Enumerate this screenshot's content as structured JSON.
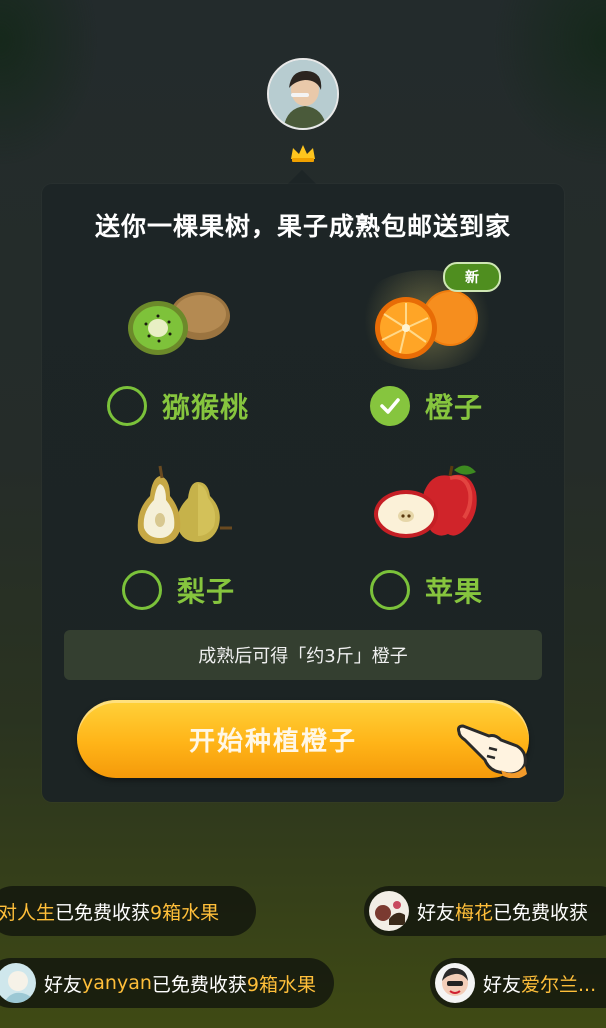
{
  "header": {
    "avatar_icon": "user-avatar",
    "crown_icon": "crown-icon"
  },
  "card": {
    "title": "送你一棵果树，果子成熟包邮送到家",
    "new_badge": "新",
    "options": [
      {
        "label": "猕猴桃",
        "icon": "kiwi-icon",
        "checked": false
      },
      {
        "label": "橙子",
        "icon": "orange-icon",
        "checked": true
      },
      {
        "label": "梨子",
        "icon": "pear-icon",
        "checked": false
      },
      {
        "label": "苹果",
        "icon": "apple-icon",
        "checked": false
      }
    ],
    "info_text": "成熟后可得「约3斤」橙子",
    "start_button": "开始种植橙子",
    "hand_icon": "pointing-hand-icon"
  },
  "tickers": [
    {
      "pre": "",
      "name": "对人生",
      "post": "已免费收获",
      "count": "9箱水果"
    },
    {
      "pre": "好友",
      "name": "梅花",
      "post": "已免费收获",
      "count": ""
    },
    {
      "pre": "好友",
      "name": "yanyan",
      "post": "已免费收获",
      "count": "9箱水果"
    },
    {
      "pre": "好友",
      "name": "爱尔兰...",
      "post": "",
      "count": ""
    }
  ],
  "colors": {
    "accent_green": "#86c53e",
    "button_orange": "#ffb418",
    "highlight": "#ffbf3a",
    "background": "#232b2c"
  }
}
